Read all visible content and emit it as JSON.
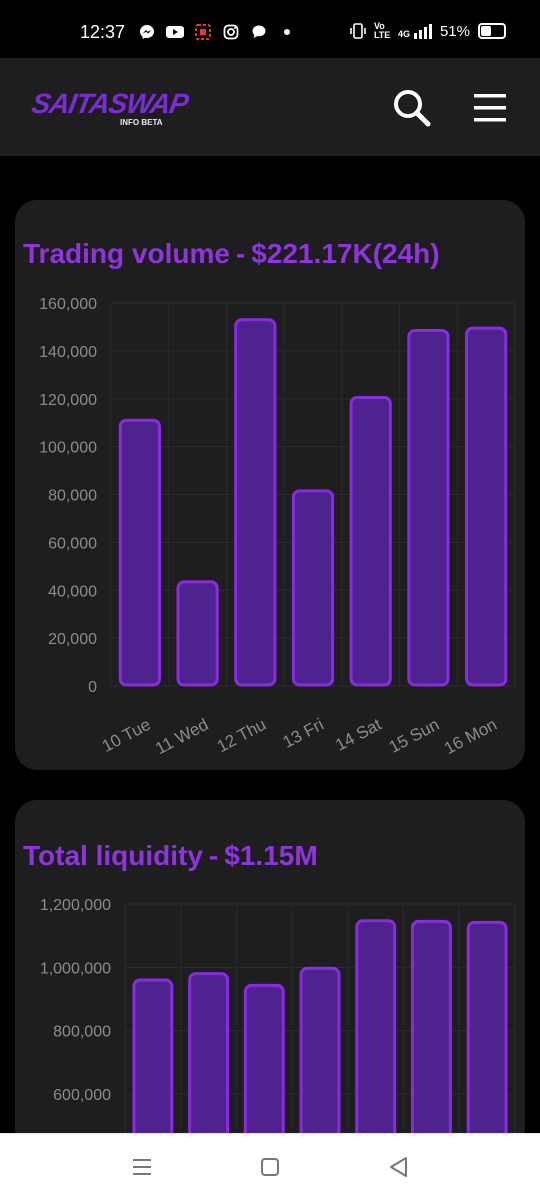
{
  "status_bar": {
    "time": "12:37",
    "battery": "51%",
    "battery_level": 0.51,
    "left_icons": [
      "messenger-icon",
      "youtube-icon",
      "app-icon",
      "instagram-icon",
      "chat-bubble-icon",
      "dot-icon"
    ],
    "right_icons": [
      "vibrate-icon",
      "volte-icon",
      "signal-4g-icon",
      "battery-icon"
    ],
    "network_labels": {
      "volte": "Vo LTE",
      "network": "4G"
    }
  },
  "app_bar": {
    "logo_text": "SAITASWAP",
    "logo_subtext": "INFO BETA",
    "accent_color": "#8f34e0"
  },
  "trading_volume": {
    "label": "Trading volume",
    "value": "$221.17K(24h)"
  },
  "total_liquidity": {
    "label": "Total liquidity",
    "value": "$1.15M"
  },
  "chart_data": [
    {
      "type": "bar",
      "title": "Trading volume - $221.17K(24h)",
      "categories": [
        "10 Tue",
        "11 Wed",
        "12 Thu",
        "13 Fri",
        "14 Sat",
        "15 Sun",
        "16 Mon"
      ],
      "values": [
        111000,
        43500,
        153000,
        81500,
        120500,
        148500,
        149500
      ],
      "ylim": [
        0,
        160000
      ],
      "yticks": [
        "0",
        "20,000",
        "40,000",
        "60,000",
        "80,000",
        "100,000",
        "120,000",
        "140,000",
        "160,000"
      ],
      "grid": true,
      "bar_color": "#4e2390",
      "bar_border_color": "#8a2be2"
    },
    {
      "type": "bar",
      "title": "Total liquidity - $1.15M",
      "values": [
        960000,
        980000,
        943000,
        997000,
        1147000,
        1145000,
        1142000
      ],
      "ylim_visible": [
        550000,
        1200000
      ],
      "yticks": [
        "600,000",
        "800,000",
        "1,000,000",
        "1,200,000"
      ],
      "grid": true,
      "bar_color": "#4e2390",
      "bar_border_color": "#8a2be2"
    }
  ],
  "nav_bar": {
    "buttons": [
      "recent-apps-button",
      "home-button",
      "back-button"
    ]
  }
}
